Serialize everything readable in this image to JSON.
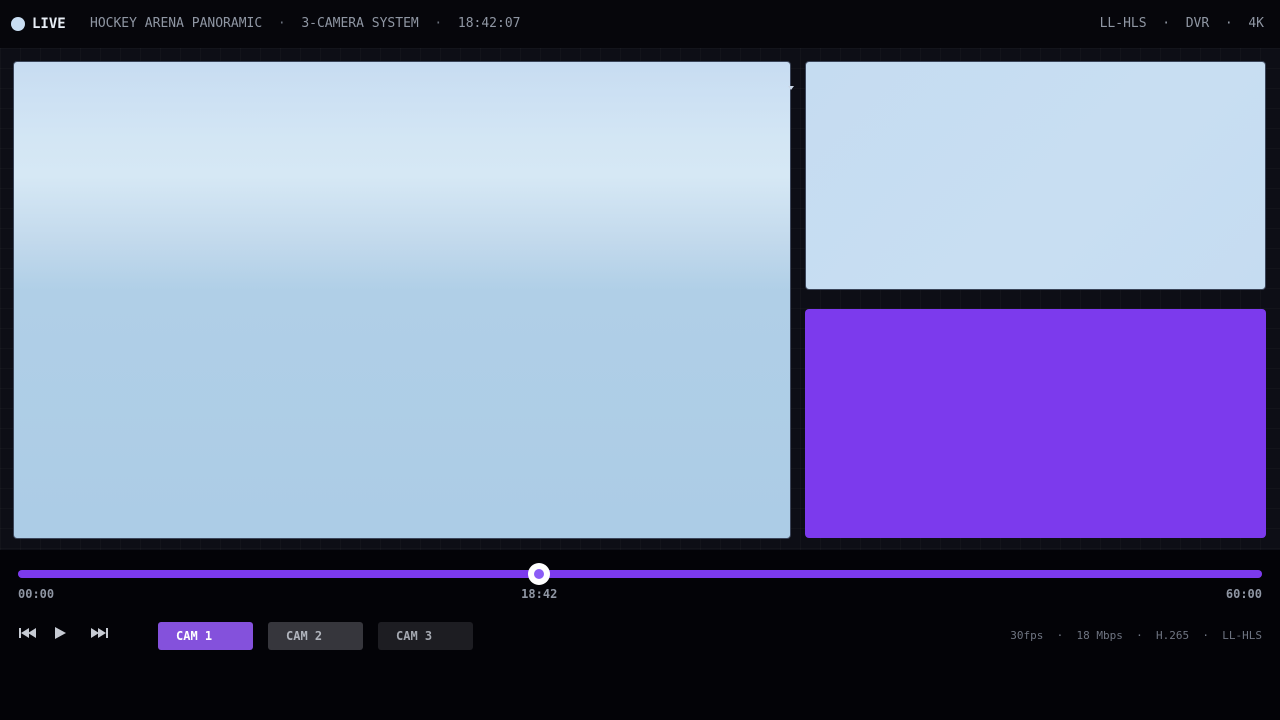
{
  "header": {
    "live_label": "LIVE",
    "title": "HOCKEY ARENA PANORAMIC",
    "system": "3-CAMERA SYSTEM",
    "clock": "18:42:07",
    "right_items": [
      "LL-HLS",
      "DVR",
      "4K"
    ],
    "separator": "·"
  },
  "timeline": {
    "start_label": "00:00",
    "current_label": "18:42",
    "end_label": "60:00",
    "progress_fraction": 0.419
  },
  "controls": {
    "skip_back_icon": "skip-back-icon",
    "play_icon": "play-icon",
    "skip_forward_icon": "skip-forward-icon"
  },
  "cameras": [
    {
      "label": "CAM 1",
      "active": true
    },
    {
      "label": "CAM 2",
      "active": false
    },
    {
      "label": "CAM 3",
      "active": false
    }
  ],
  "stream_info": [
    "30fps",
    "18 Mbps",
    "H.265",
    "LL-HLS"
  ],
  "colors": {
    "accent": "#7c3aed",
    "live_dot": "#c9def3",
    "ice": "#aecde6"
  }
}
